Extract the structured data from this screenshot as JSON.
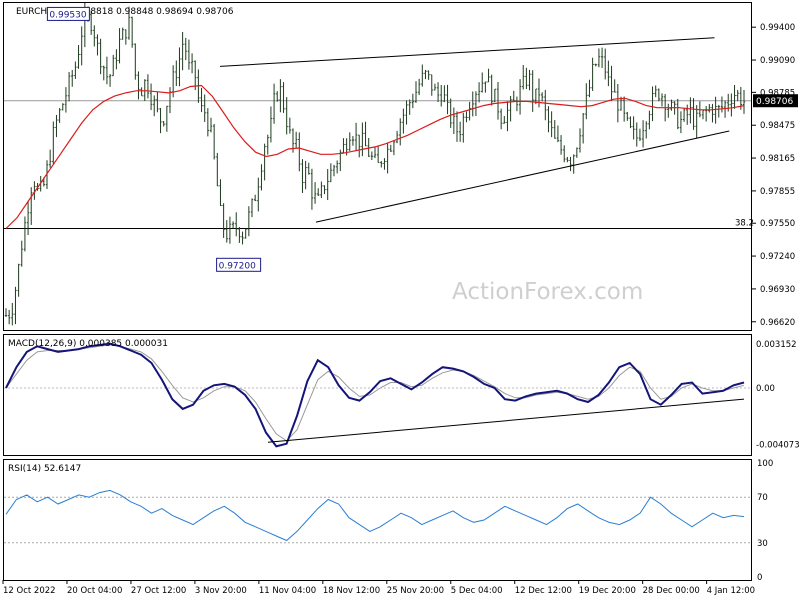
{
  "chart_data": {
    "type": "candlestick",
    "symbol_header": "EURCHF,H4",
    "ohlc_header": "0.98818 0.98848 0.98694 0.98706",
    "price_axis": {
      "ticks": [
        "0.99400",
        "0.99090",
        "0.98785",
        "0.98475",
        "0.98165",
        "0.97855",
        "0.97550",
        "0.97240",
        "0.96930",
        "0.96620"
      ],
      "ylim": [
        0.9658,
        0.996
      ],
      "current_price_label": "0.98706",
      "current_price": 0.98706
    },
    "x_ticks": [
      "12 Oct 2022",
      "20 Oct 04:00",
      "27 Oct 12:00",
      "3 Nov 20:00",
      "11 Nov 04:00",
      "18 Nov 12:00",
      "25 Nov 20:00",
      "5 Dec 04:00",
      "12 Dec 12:00",
      "19 Dec 20:00",
      "28 Dec 00:00",
      "4 Jan 12:00"
    ],
    "annotations": {
      "high_label": "0.99530",
      "high_value": 0.9953,
      "low_label": "0.97200",
      "low_value": 0.972,
      "fib_label": "38.2",
      "fib_level": 0.975
    },
    "watermark": "ActionForex.com",
    "price_path": [
      [
        0.9668,
        0.9672
      ],
      [
        0.97,
        0.9738
      ],
      [
        0.977,
        0.98
      ],
      [
        0.9782,
        0.979
      ],
      [
        0.9815,
        0.9845
      ],
      [
        0.986,
        0.9875
      ],
      [
        0.989,
        0.9905
      ],
      [
        0.9935,
        0.9948
      ],
      [
        0.9945,
        0.992
      ],
      [
        0.9905,
        0.989
      ],
      [
        0.9905,
        0.9925
      ],
      [
        0.9935,
        0.9945
      ],
      [
        0.9895,
        0.988
      ],
      [
        0.989,
        0.9875
      ],
      [
        0.986,
        0.985
      ],
      [
        0.9872,
        0.989
      ],
      [
        0.9905,
        0.993
      ],
      [
        0.99,
        0.9898
      ],
      [
        0.9862,
        0.986
      ],
      [
        0.984,
        0.98
      ],
      [
        0.9755,
        0.9745
      ],
      [
        0.9748,
        0.9752
      ],
      [
        0.9745,
        0.976
      ],
      [
        0.9775,
        0.98
      ],
      [
        0.983,
        0.984
      ],
      [
        0.9878,
        0.988
      ],
      [
        0.9855,
        0.983
      ],
      [
        0.9825,
        0.98
      ],
      [
        0.9805,
        0.978
      ],
      [
        0.9775,
        0.979
      ],
      [
        0.98,
        0.981
      ],
      [
        0.982,
        0.983
      ],
      [
        0.9845,
        0.9835
      ],
      [
        0.9832,
        0.9825
      ],
      [
        0.9815,
        0.9808
      ],
      [
        0.982,
        0.9825
      ],
      [
        0.9838,
        0.985
      ],
      [
        0.986,
        0.987
      ],
      [
        0.9878,
        0.989
      ],
      [
        0.9895,
        0.9885
      ],
      [
        0.9875,
        0.988
      ],
      [
        0.986,
        0.985
      ],
      [
        0.984,
        0.9855
      ],
      [
        0.987,
        0.988
      ],
      [
        0.9885,
        0.9895
      ],
      [
        0.988,
        0.987
      ],
      [
        0.9855,
        0.986
      ],
      [
        0.9865,
        0.9875
      ],
      [
        0.9885,
        0.9895
      ],
      [
        0.987,
        0.988
      ],
      [
        0.986,
        0.9845
      ],
      [
        0.983,
        0.9825
      ],
      [
        0.982,
        0.9815
      ],
      [
        0.9832,
        0.9855
      ],
      [
        0.9875,
        0.99
      ],
      [
        0.991,
        0.9905
      ],
      [
        0.9885,
        0.9875
      ],
      [
        0.9865,
        0.985
      ],
      [
        0.984,
        0.9835
      ],
      [
        0.9845,
        0.986
      ],
      [
        0.987,
        0.988
      ],
      [
        0.9875,
        0.9865
      ],
      [
        0.986,
        0.985
      ],
      [
        0.9855,
        0.986
      ],
      [
        0.985,
        0.9855
      ],
      [
        0.986,
        0.9865
      ],
      [
        0.986,
        0.9865
      ],
      [
        0.987,
        0.9878
      ],
      [
        0.9875,
        0.987
      ]
    ],
    "moving_average": [
      0.975,
      0.976,
      0.9775,
      0.979,
      0.9805,
      0.982,
      0.9835,
      0.985,
      0.9862,
      0.987,
      0.9875,
      0.9878,
      0.988,
      0.988,
      0.9879,
      0.9878,
      0.988,
      0.9884,
      0.9885,
      0.9875,
      0.986,
      0.9845,
      0.9832,
      0.9822,
      0.9818,
      0.982,
      0.9825,
      0.9826,
      0.9823,
      0.982,
      0.982,
      0.9821,
      0.9823,
      0.9825,
      0.9827,
      0.983,
      0.9834,
      0.9838,
      0.9843,
      0.9848,
      0.9853,
      0.9857,
      0.986,
      0.9863,
      0.9866,
      0.9868,
      0.9869,
      0.987,
      0.987,
      0.9869,
      0.9868,
      0.9867,
      0.9866,
      0.9865,
      0.9866,
      0.9869,
      0.9872,
      0.9873,
      0.987,
      0.9866,
      0.9864,
      0.9864,
      0.9864,
      0.9863,
      0.9862,
      0.9862,
      0.9863,
      0.9864,
      0.9866
    ],
    "trendlines": [
      {
        "role": "upper-channel",
        "from": [
          0.29,
          0.9903
        ],
        "to": [
          0.96,
          0.993
        ]
      },
      {
        "role": "lower-channel",
        "from": [
          0.42,
          0.9756
        ],
        "to": [
          0.98,
          0.9842
        ]
      }
    ],
    "macd": {
      "label": "MACD(12,26,9) 0.000385 0.000031",
      "ticks": [
        "0.003152",
        "0.00",
        "-0.004073"
      ],
      "ylim": [
        -0.0046,
        0.0036
      ],
      "main": [
        0.0,
        0.0015,
        0.0026,
        0.003,
        0.0028,
        0.0026,
        0.0027,
        0.0028,
        0.003,
        0.0031,
        0.0032,
        0.003,
        0.0027,
        0.0024,
        0.0018,
        0.0006,
        -0.0008,
        -0.0015,
        -0.0012,
        -0.0002,
        0.0002,
        0.0003,
        0.0001,
        -0.0005,
        -0.0015,
        -0.0032,
        -0.0042,
        -0.004,
        -0.002,
        0.0005,
        0.002,
        0.0015,
        0.0002,
        -0.0007,
        -0.0009,
        -0.0003,
        0.0005,
        0.0007,
        0.0003,
        -0.0001,
        0.0004,
        0.001,
        0.0015,
        0.0014,
        0.0012,
        0.0008,
        0.0003,
        0.0,
        -0.0008,
        -0.0009,
        -0.0006,
        -0.0004,
        -0.0003,
        -0.0002,
        -0.0004,
        -0.0008,
        -0.001,
        -0.0005,
        0.0004,
        0.0015,
        0.0018,
        0.001,
        -0.0008,
        -0.0012,
        -0.0005,
        0.0003,
        0.0004,
        -0.0004,
        -0.0003,
        -0.0002,
        0.0002,
        0.0004
      ],
      "signal": [
        0.0,
        0.001,
        0.002,
        0.0026,
        0.0027,
        0.0027,
        0.0027,
        0.0028,
        0.0029,
        0.003,
        0.0031,
        0.003,
        0.0028,
        0.0026,
        0.0021,
        0.0012,
        0.0002,
        -0.0007,
        -0.001,
        -0.0007,
        -0.0002,
        0.0001,
        0.0001,
        -0.0002,
        -0.001,
        -0.0022,
        -0.0033,
        -0.0038,
        -0.003,
        -0.0012,
        0.0006,
        0.0012,
        0.0008,
        0.0,
        -0.0006,
        -0.0005,
        0.0,
        0.0004,
        0.0004,
        0.0001,
        0.0002,
        0.0007,
        0.0011,
        0.0013,
        0.0012,
        0.0009,
        0.0005,
        0.0001,
        -0.0004,
        -0.0007,
        -0.0007,
        -0.0005,
        -0.0004,
        -0.0003,
        -0.0004,
        -0.0006,
        -0.0008,
        -0.0006,
        0.0,
        0.0009,
        0.0015,
        0.0012,
        0.0,
        -0.0008,
        -0.0006,
        0.0,
        0.0003,
        0.0,
        -0.0002,
        -0.0002,
        0.0,
        0.0002
      ],
      "trendline": {
        "from": [
          0.355,
          -0.0039
        ],
        "to": [
          1.0,
          -0.0008
        ]
      }
    },
    "rsi": {
      "label": "RSI(14) 52.6147",
      "ticks": [
        "100",
        "70",
        "30",
        "0"
      ],
      "levels": [
        70,
        30
      ],
      "ylim": [
        0,
        100
      ],
      "values": [
        55,
        68,
        72,
        66,
        70,
        64,
        68,
        72,
        70,
        74,
        76,
        72,
        66,
        62,
        56,
        60,
        54,
        50,
        46,
        52,
        58,
        62,
        56,
        48,
        44,
        40,
        36,
        32,
        40,
        50,
        60,
        68,
        64,
        52,
        46,
        40,
        44,
        50,
        56,
        52,
        46,
        50,
        54,
        58,
        52,
        48,
        50,
        56,
        62,
        58,
        54,
        50,
        46,
        52,
        60,
        64,
        58,
        52,
        48,
        46,
        50,
        56,
        70,
        64,
        56,
        50,
        44,
        50,
        56,
        52,
        54,
        53
      ]
    }
  }
}
